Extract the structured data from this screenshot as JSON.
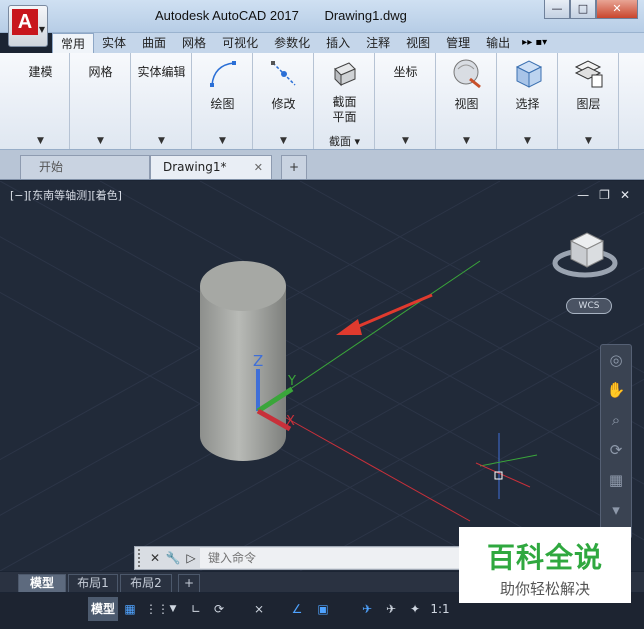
{
  "window": {
    "app_name": "Autodesk AutoCAD 2017",
    "document_name": "Drawing1.dwg",
    "controls": {
      "minimize": "—",
      "restore": "□",
      "close": "✕"
    }
  },
  "ribbon_tabs": [
    "常用",
    "实体",
    "曲面",
    "网格",
    "可视化",
    "参数化",
    "插入",
    "注释",
    "视图",
    "管理",
    "输出"
  ],
  "ribbon_tabs_more": "▸▸ ▪▾",
  "ribbon_panels": [
    {
      "label": "建模"
    },
    {
      "label": "网格"
    },
    {
      "label": "实体编辑"
    },
    {
      "label": "绘图"
    },
    {
      "label": "修改"
    },
    {
      "label": "截面\n平面",
      "footer": "截面 ▾"
    },
    {
      "label": "坐标"
    },
    {
      "label": "视图"
    },
    {
      "label": "选择"
    },
    {
      "label": "图层"
    }
  ],
  "doc_tabs": {
    "start": "开始",
    "drawing": "Drawing1*",
    "close": "✕",
    "add": "+"
  },
  "viewport": {
    "label": "[−][东南等轴测][着色]",
    "controls": [
      "—",
      "❐",
      "✕"
    ],
    "wcs_label": "WCS",
    "axis_labels": {
      "x": "X",
      "y": "Y",
      "z": "Z"
    }
  },
  "command_line": {
    "close": "✕",
    "settings": "🔧",
    "prompt_icon": "▷",
    "placeholder": "键入命令"
  },
  "layout_tabs": [
    "模型",
    "布局1",
    "布局2",
    "+"
  ],
  "status_bar": {
    "model": "模型",
    "scale": "1:1"
  },
  "watermark": {
    "title": "百科全说",
    "subtitle": "助你轻松解决"
  },
  "colors": {
    "viewport_bg": "#212a39",
    "grid_line": "#2c3547",
    "x_axis": "#c8303a",
    "y_axis": "#3aa63a",
    "z_axis": "#3f6fd8",
    "arrow": "#e03a2e",
    "watermark_green": "#2fa83f"
  }
}
